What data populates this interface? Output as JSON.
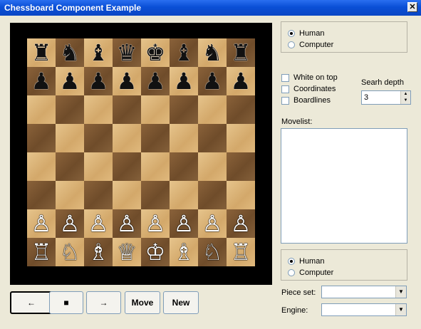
{
  "window": {
    "title": "Chessboard Component Example",
    "close_glyph": "✕"
  },
  "board": {
    "rows": [
      [
        {
          "p": "♜",
          "c": "b"
        },
        {
          "p": "♞",
          "c": "b"
        },
        {
          "p": "♝",
          "c": "b"
        },
        {
          "p": "♛",
          "c": "b"
        },
        {
          "p": "♚",
          "c": "b"
        },
        {
          "p": "♝",
          "c": "b"
        },
        {
          "p": "♞",
          "c": "b"
        },
        {
          "p": "♜",
          "c": "b"
        }
      ],
      [
        {
          "p": "♟",
          "c": "b"
        },
        {
          "p": "♟",
          "c": "b"
        },
        {
          "p": "♟",
          "c": "b"
        },
        {
          "p": "♟",
          "c": "b"
        },
        {
          "p": "♟",
          "c": "b"
        },
        {
          "p": "♟",
          "c": "b"
        },
        {
          "p": "♟",
          "c": "b"
        },
        {
          "p": "♟",
          "c": "b"
        }
      ],
      [
        null,
        null,
        null,
        null,
        null,
        null,
        null,
        null
      ],
      [
        null,
        null,
        null,
        null,
        null,
        null,
        null,
        null
      ],
      [
        null,
        null,
        null,
        null,
        null,
        null,
        null,
        null
      ],
      [
        null,
        null,
        null,
        null,
        null,
        null,
        null,
        null
      ],
      [
        {
          "p": "♙",
          "c": "w"
        },
        {
          "p": "♙",
          "c": "w"
        },
        {
          "p": "♙",
          "c": "w"
        },
        {
          "p": "♙",
          "c": "w"
        },
        {
          "p": "♙",
          "c": "w"
        },
        {
          "p": "♙",
          "c": "w"
        },
        {
          "p": "♙",
          "c": "w"
        },
        {
          "p": "♙",
          "c": "w"
        }
      ],
      [
        {
          "p": "♖",
          "c": "w"
        },
        {
          "p": "♘",
          "c": "w"
        },
        {
          "p": "♗",
          "c": "w"
        },
        {
          "p": "♕",
          "c": "w"
        },
        {
          "p": "♔",
          "c": "w"
        },
        {
          "p": "♗",
          "c": "w"
        },
        {
          "p": "♘",
          "c": "w"
        },
        {
          "p": "♖",
          "c": "w"
        }
      ]
    ]
  },
  "buttons": {
    "back": "←",
    "stop": "■",
    "forward": "→",
    "move": "Move",
    "new": "New"
  },
  "top_player": {
    "options": [
      "Human",
      "Computer"
    ],
    "selected": 0
  },
  "bottom_player": {
    "options": [
      "Human",
      "Computer"
    ],
    "selected": 0
  },
  "options": {
    "white_on_top": "White on top",
    "coordinates": "Coordinates",
    "boardlines": "Boardlines"
  },
  "search_depth": {
    "label": "Searh depth",
    "value": "3"
  },
  "movelist": {
    "label": "Movelist:"
  },
  "piece_set": {
    "label": "Piece set:",
    "value": ""
  },
  "engine": {
    "label": "Engine:",
    "value": ""
  }
}
